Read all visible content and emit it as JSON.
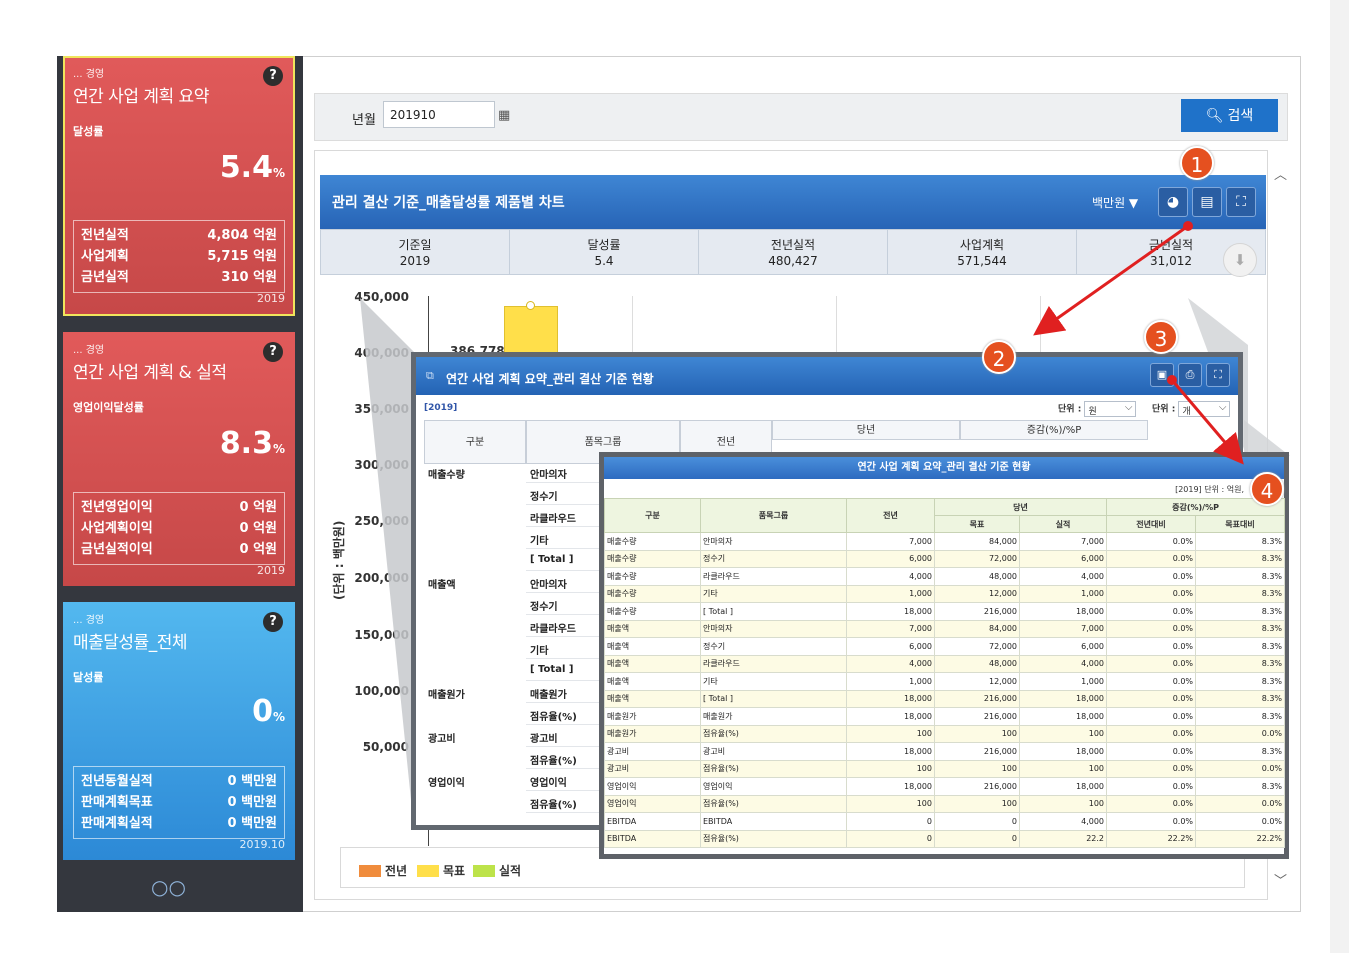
{
  "sidebar": {
    "cards": [
      {
        "path": "... 경영",
        "title": "연간 사업 계획 요약",
        "metric_label": "달성률",
        "value": "5.4",
        "unit": "%",
        "stats": [
          [
            "전년실적",
            "4,804 억원"
          ],
          [
            "사업계획",
            "5,715 억원"
          ],
          [
            "금년실적",
            "310 억원"
          ]
        ],
        "year": "2019",
        "help": "?"
      },
      {
        "path": "... 경영",
        "title": "연간 사업 계획 & 실적",
        "metric_label": "영업이익달성률",
        "value": "8.3",
        "unit": "%",
        "stats": [
          [
            "전년영업이익",
            "0 억원"
          ],
          [
            "사업계획이익",
            "0 억원"
          ],
          [
            "금년실적이익",
            "0 억원"
          ]
        ],
        "year": "2019",
        "help": "?"
      },
      {
        "path": "... 경영",
        "title": "매출달성률_전체",
        "metric_label": "달성률",
        "value": "0",
        "unit": "%",
        "stats": [
          [
            "전년동월실적",
            "0 백만원"
          ],
          [
            "판매계획목표",
            "0 백만원"
          ],
          [
            "판매계획실적",
            "0 백만원"
          ]
        ],
        "year": "2019.10",
        "help": "?"
      }
    ],
    "pager": "○○"
  },
  "filter": {
    "label": "년월",
    "value": "201910",
    "search_label": "검색"
  },
  "chart_panel": {
    "title": "관리 결산 기준_매출달성률 제품별 차트",
    "unit": "백만원 ▼",
    "stats": [
      [
        "기준일",
        "2019"
      ],
      [
        "달성률",
        "5.4"
      ],
      [
        "전년실적",
        "480,427"
      ],
      [
        "사업계획",
        "571,544"
      ],
      [
        "금년실적",
        "31,012"
      ]
    ],
    "yaxis_title": "(단위 : 백만원)",
    "legend": [
      "전년",
      "목표",
      "실적"
    ],
    "legend_colors": [
      "#f08c3c",
      "#ffdf4a",
      "#bde34a"
    ],
    "partial_label": "386,778"
  },
  "chart_data": {
    "type": "bar",
    "yticks": [
      "450,000",
      "400,000",
      "350,000",
      "300,000",
      "250,000",
      "200,000",
      "150,000",
      "100,000",
      "50,000"
    ],
    "ylabel": "(단위 : 백만원)",
    "series": [
      {
        "name": "전년"
      },
      {
        "name": "목표"
      },
      {
        "name": "실적"
      }
    ],
    "visible_annotation": "386,778"
  },
  "window2": {
    "title": "연간 사업 계획 요약_관리 결산 기준 현황",
    "year": "[2019]",
    "unit1_label": "단위 :",
    "unit1_value": "원",
    "unit2_label": "단위 :",
    "unit2_value": "개",
    "headers": [
      "구분",
      "품목그룹",
      "전년",
      "당년",
      "증감(%)/%P"
    ],
    "rows": [
      [
        "매출수량",
        "안마의자"
      ],
      [
        "",
        "정수기"
      ],
      [
        "",
        "라클라우드"
      ],
      [
        "",
        "기타"
      ],
      [
        "",
        "[ Total ]"
      ],
      [
        "매출액",
        "안마의자"
      ],
      [
        "",
        "정수기"
      ],
      [
        "",
        "라클라우드"
      ],
      [
        "",
        "기타"
      ],
      [
        "",
        "[ Total ]"
      ],
      [
        "매출원가",
        "매출원가"
      ],
      [
        "",
        "점유율(%)"
      ],
      [
        "광고비",
        "광고비"
      ],
      [
        "",
        "점유율(%)"
      ],
      [
        "영업이익",
        "영업이익"
      ],
      [
        "",
        "점유율(%)"
      ]
    ]
  },
  "window3": {
    "title": "연간 사업 계획 요약_관리 결산 기준 현황",
    "meta": "[2019]   단위 : 억원,",
    "headers": {
      "c1": "구분",
      "c2": "품목그룹",
      "c3": "전년",
      "group1": "당년",
      "g1a": "목표",
      "g1b": "실적",
      "group2": "증감(%)/%P",
      "g2a": "전년대비",
      "g2b": "목표대비"
    },
    "rows": [
      [
        "매출수량",
        "안마의자",
        "7,000",
        "84,000",
        "7,000",
        "0.0%",
        "8.3%"
      ],
      [
        "매출수량",
        "정수기",
        "6,000",
        "72,000",
        "6,000",
        "0.0%",
        "8.3%"
      ],
      [
        "매출수량",
        "라클라우드",
        "4,000",
        "48,000",
        "4,000",
        "0.0%",
        "8.3%"
      ],
      [
        "매출수량",
        "기타",
        "1,000",
        "12,000",
        "1,000",
        "0.0%",
        "8.3%"
      ],
      [
        "매출수량",
        "[ Total ]",
        "18,000",
        "216,000",
        "18,000",
        "0.0%",
        "8.3%"
      ],
      [
        "매출액",
        "안마의자",
        "7,000",
        "84,000",
        "7,000",
        "0.0%",
        "8.3%"
      ],
      [
        "매출액",
        "정수기",
        "6,000",
        "72,000",
        "6,000",
        "0.0%",
        "8.3%"
      ],
      [
        "매출액",
        "라클라우드",
        "4,000",
        "48,000",
        "4,000",
        "0.0%",
        "8.3%"
      ],
      [
        "매출액",
        "기타",
        "1,000",
        "12,000",
        "1,000",
        "0.0%",
        "8.3%"
      ],
      [
        "매출액",
        "[ Total ]",
        "18,000",
        "216,000",
        "18,000",
        "0.0%",
        "8.3%"
      ],
      [
        "매출원가",
        "매출원가",
        "18,000",
        "216,000",
        "18,000",
        "0.0%",
        "8.3%"
      ],
      [
        "매출원가",
        "점유율(%)",
        "100",
        "100",
        "100",
        "0.0%",
        "0.0%"
      ],
      [
        "광고비",
        "광고비",
        "18,000",
        "216,000",
        "18,000",
        "0.0%",
        "8.3%"
      ],
      [
        "광고비",
        "점유율(%)",
        "100",
        "100",
        "100",
        "0.0%",
        "0.0%"
      ],
      [
        "영업이익",
        "영업이익",
        "18,000",
        "216,000",
        "18,000",
        "0.0%",
        "8.3%"
      ],
      [
        "영업이익",
        "점유율(%)",
        "100",
        "100",
        "100",
        "0.0%",
        "0.0%"
      ],
      [
        "EBITDA",
        "EBITDA",
        "0",
        "0",
        "4,000",
        "0.0%",
        "0.0%"
      ],
      [
        "EBITDA",
        "점유율(%)",
        "0",
        "0",
        "22.2",
        "22.2%",
        "22.2%"
      ]
    ]
  },
  "callouts": [
    "1",
    "2",
    "3",
    "4"
  ],
  "colors": {
    "accent": "#2764b6",
    "callout": "#e5501f",
    "card_red": "#d65050",
    "card_blue": "#3fa2e6"
  }
}
